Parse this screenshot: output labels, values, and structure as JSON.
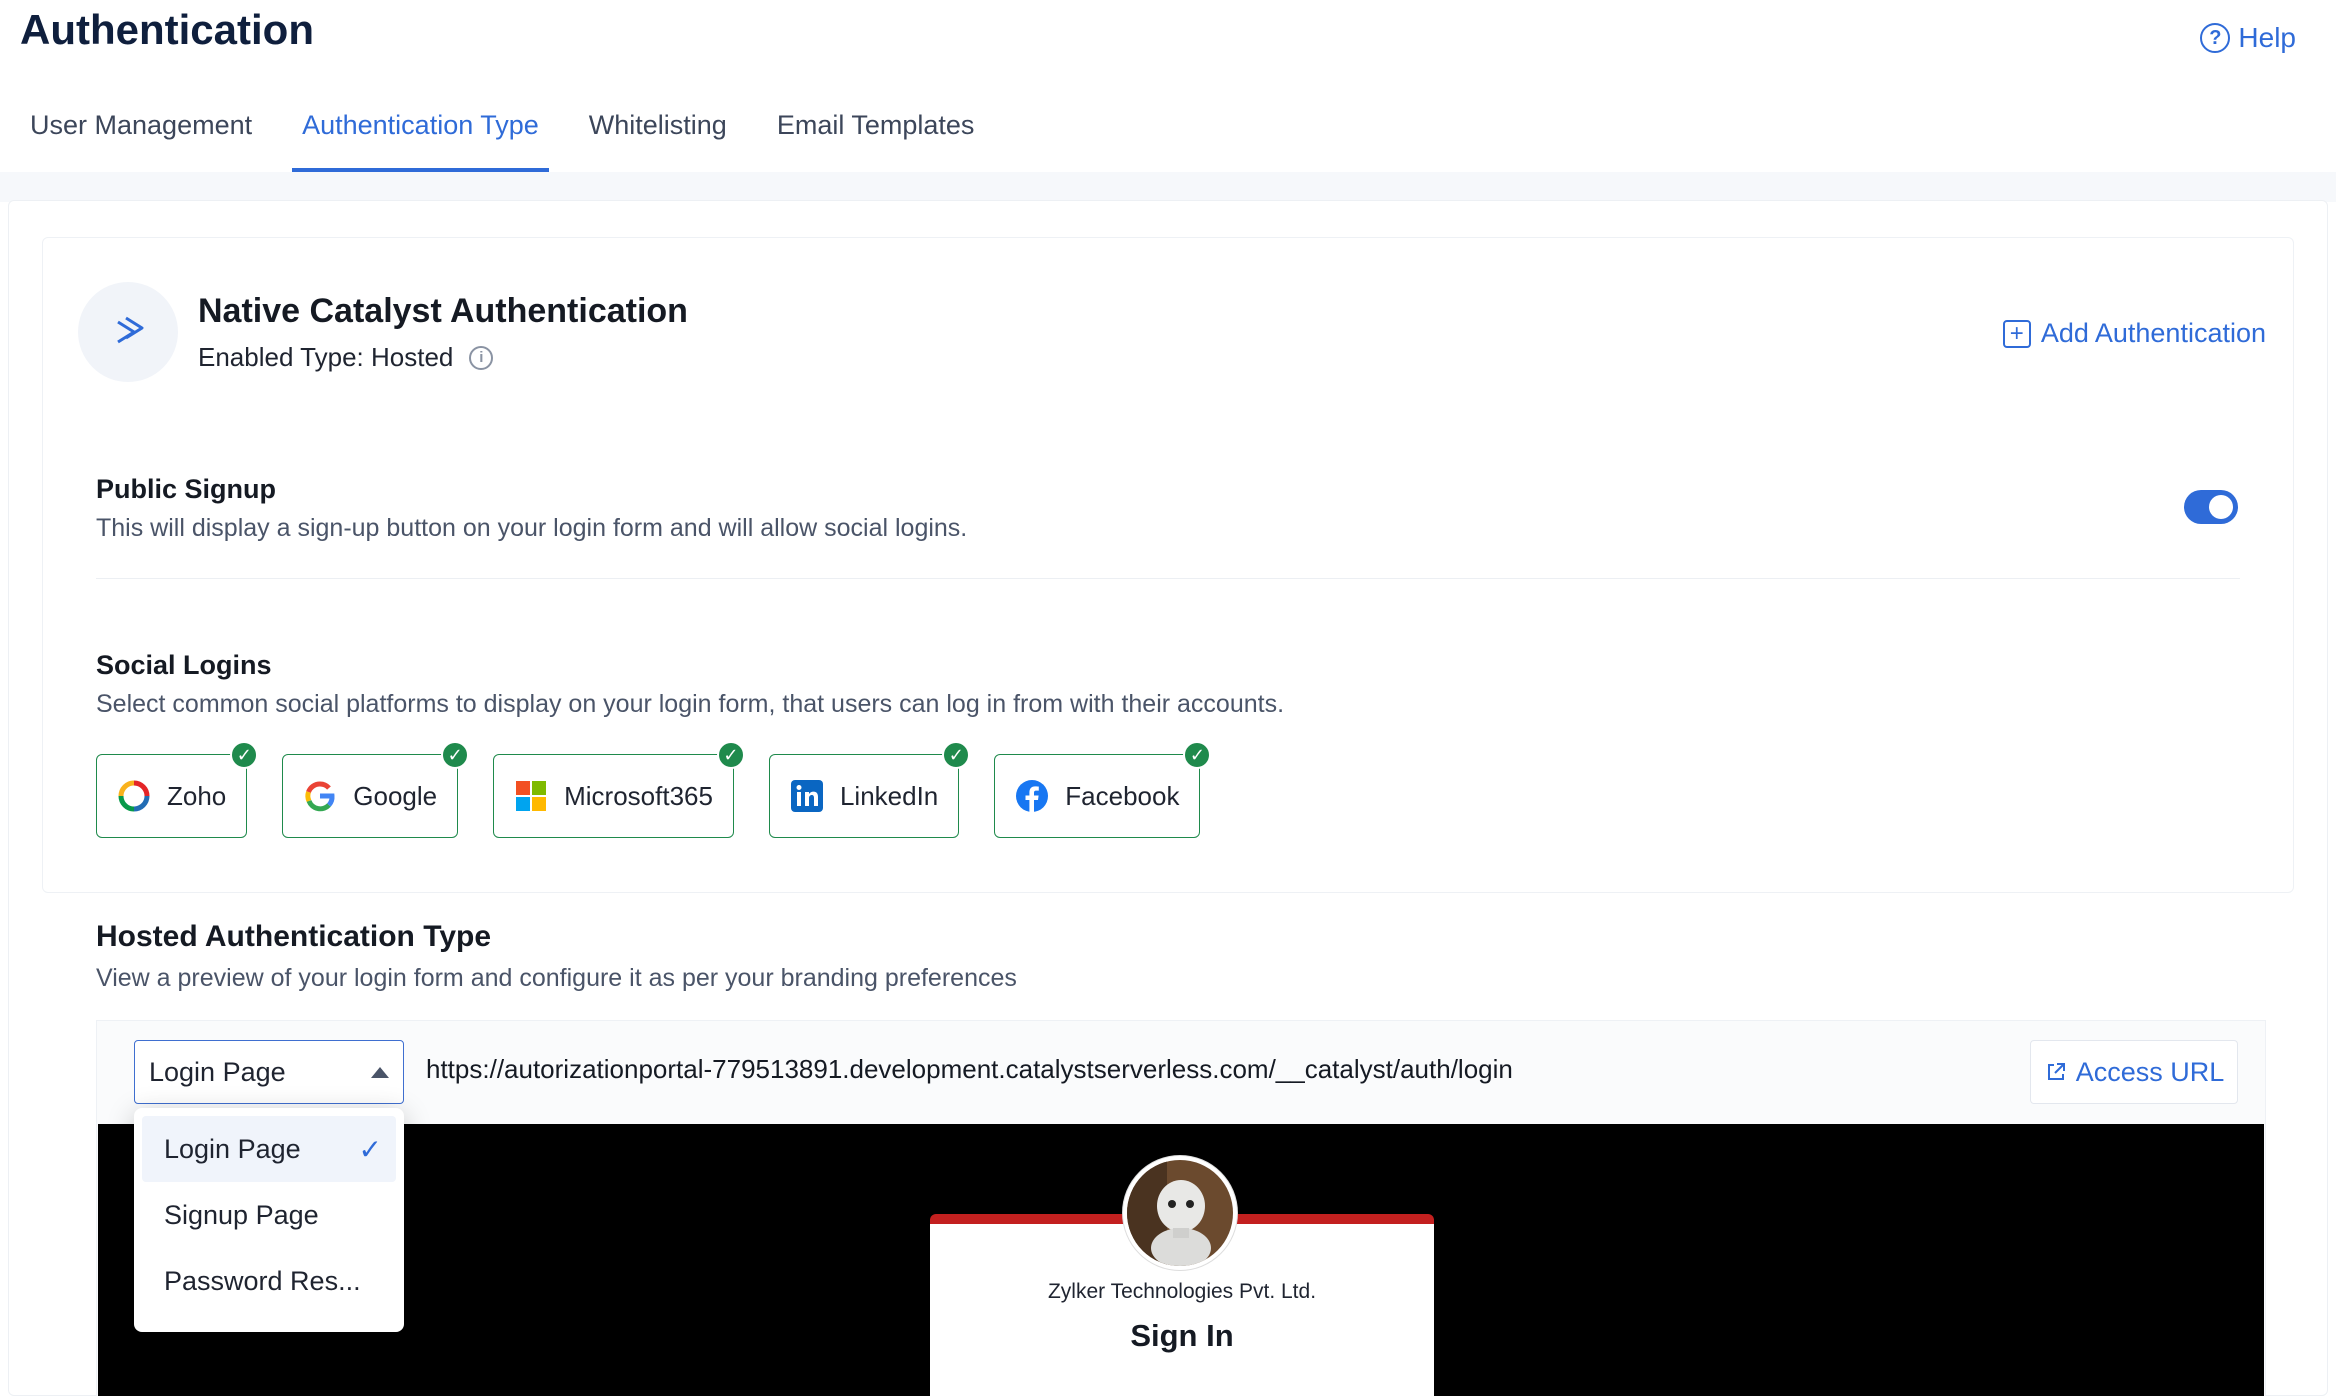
{
  "header": {
    "title": "Authentication",
    "help_label": "Help"
  },
  "tabs": [
    {
      "label": "User Management"
    },
    {
      "label": "Authentication Type"
    },
    {
      "label": "Whitelisting"
    },
    {
      "label": "Email Templates"
    }
  ],
  "auth": {
    "title": "Native Catalyst Authentication",
    "enabled_type": "Enabled Type: Hosted",
    "add_label": "Add Authentication"
  },
  "public_signup": {
    "title": "Public Signup",
    "desc": "This will display a sign-up button on your login form and will allow social logins.",
    "enabled": true
  },
  "social": {
    "title": "Social Logins",
    "desc": "Select common social platforms to display on your login form, that users can log in from with their accounts.",
    "items": [
      {
        "label": "Zoho",
        "icon": "zoho-icon"
      },
      {
        "label": "Google",
        "icon": "google-icon"
      },
      {
        "label": "Microsoft365",
        "icon": "microsoft-icon"
      },
      {
        "label": "LinkedIn",
        "icon": "linkedin-icon"
      },
      {
        "label": "Facebook",
        "icon": "facebook-icon"
      }
    ]
  },
  "hosted": {
    "title": "Hosted Authentication Type",
    "desc": "View a preview of your login form and configure it as per your branding preferences",
    "selected": "Login Page",
    "url": "https://autorizationportal-779513891.development.catalystserverless.com/__catalyst/auth/login",
    "access_label": "Access URL",
    "options": [
      "Login Page",
      "Signup Page",
      "Password Res..."
    ]
  },
  "preview": {
    "company": "Zylker Technologies Pvt. Ltd.",
    "signin": "Sign In"
  },
  "colors": {
    "accent": "#2f6bd8",
    "success": "#1f8a4c",
    "brand_red": "#c3201f"
  }
}
